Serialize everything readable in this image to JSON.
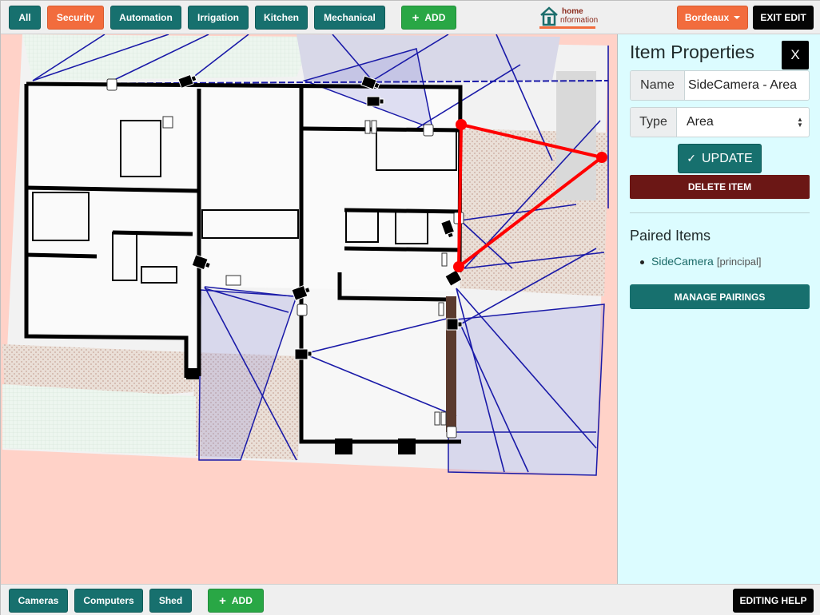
{
  "top_nav": {
    "buttons": [
      {
        "label": "All",
        "style": "teal"
      },
      {
        "label": "Security",
        "style": "orange"
      },
      {
        "label": "Automation",
        "style": "teal"
      },
      {
        "label": "Irrigation",
        "style": "teal"
      },
      {
        "label": "Kitchen",
        "style": "teal"
      },
      {
        "label": "Mechanical",
        "style": "teal"
      }
    ],
    "add_label": "ADD",
    "logo_line1": "home",
    "logo_line2": "nformation",
    "location_label": "Bordeaux",
    "exit_label": "EXIT EDIT"
  },
  "panel": {
    "title": "Item Properties",
    "close_label": "X",
    "name_label": "Name",
    "name_value": "SideCamera - Area",
    "type_label": "Type",
    "type_value": "Area",
    "update_label": "UPDATE",
    "delete_label": "DELETE ITEM",
    "paired_title": "Paired Items",
    "paired_items": [
      {
        "name": "SideCamera",
        "role": "[principal]"
      }
    ],
    "manage_label": "MANAGE PAIRINGS"
  },
  "bottom_nav": {
    "buttons": [
      {
        "label": "Cameras"
      },
      {
        "label": "Computers"
      },
      {
        "label": "Shed"
      }
    ],
    "add_label": "ADD",
    "help_label": "EDITING HELP"
  },
  "colors": {
    "teal": "#17706e",
    "orange": "#f26c3d",
    "green": "#29a745",
    "map_background": "#ffd2c8",
    "panel_background": "#dcfcff",
    "selection": "#ff0000",
    "coverage_lines": "#1a1aa8"
  },
  "icons": [
    "home-logo-icon",
    "plus-icon",
    "caret-down-icon",
    "check-icon",
    "camera-icon",
    "sensor-icon",
    "vertex-handle-icon"
  ]
}
